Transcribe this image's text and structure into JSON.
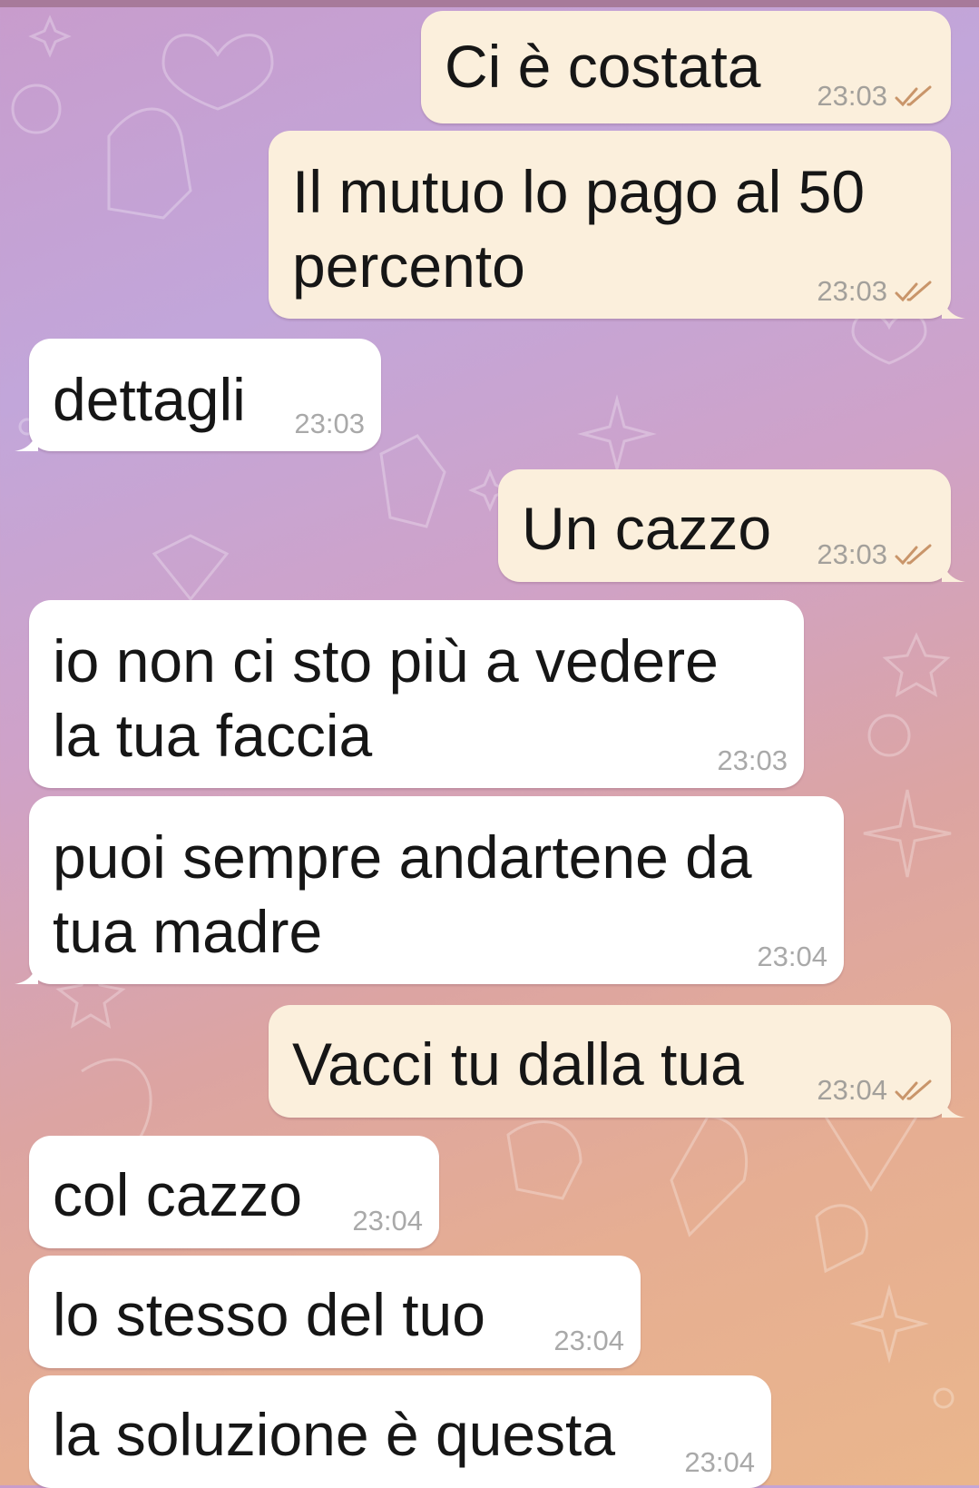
{
  "chat": {
    "messages": [
      {
        "direction": "outgoing",
        "text": [
          "Ci è costata"
        ],
        "time": "23:03",
        "status": "read-double-check-icon"
      },
      {
        "direction": "outgoing",
        "text": [
          "Il mutuo lo pago al 50",
          "percento"
        ],
        "time": "23:03",
        "status": "read-double-check-icon"
      },
      {
        "direction": "incoming",
        "text": [
          "dettagli"
        ],
        "time": "23:03"
      },
      {
        "direction": "outgoing",
        "text": [
          "Un cazzo"
        ],
        "time": "23:03",
        "status": "read-double-check-icon"
      },
      {
        "direction": "incoming",
        "text": [
          "io non ci sto più a vedere",
          "la tua faccia"
        ],
        "time": "23:03"
      },
      {
        "direction": "incoming",
        "text": [
          "puoi sempre andartene da",
          "tua madre"
        ],
        "time": "23:04"
      },
      {
        "direction": "outgoing",
        "text": [
          "Vacci tu dalla tua"
        ],
        "time": "23:04",
        "status": "read-double-check-icon"
      },
      {
        "direction": "incoming",
        "text": [
          "col cazzo"
        ],
        "time": "23:04"
      },
      {
        "direction": "incoming",
        "text": [
          "lo stesso del tuo"
        ],
        "time": "23:04"
      },
      {
        "direction": "incoming",
        "text": [
          "la soluzione è questa"
        ],
        "time": "23:04"
      }
    ]
  },
  "colors": {
    "outgoing_bubble": "#fbefdc",
    "incoming_bubble": "#ffffff",
    "read_ticks": "#c9956a",
    "wallpaper_top": "#c2a6da",
    "wallpaper_bottom": "#eab68c"
  }
}
